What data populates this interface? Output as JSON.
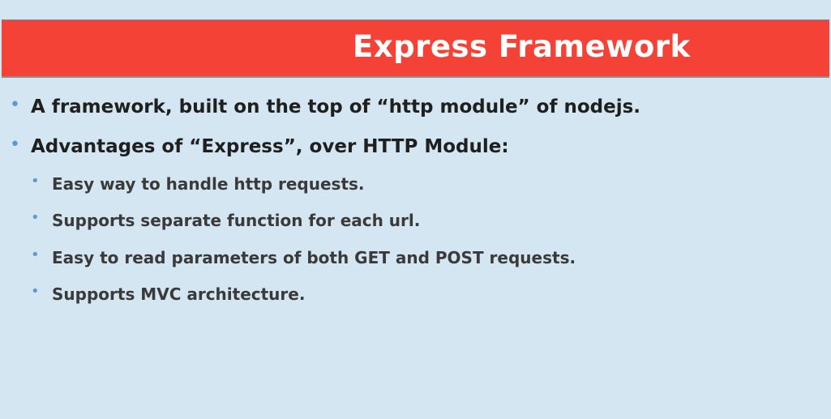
{
  "slide": {
    "title": "Express Framework",
    "bullets": [
      {
        "level": 1,
        "text": "A framework, built on the top of “http module” of nodejs."
      },
      {
        "level": 1,
        "text": "Advantages of “Express”, over HTTP Module:"
      },
      {
        "level": 2,
        "text": "Easy way to handle http requests."
      },
      {
        "level": 2,
        "text": "Supports separate function for each url."
      },
      {
        "level": 2,
        "text": "Easy to read parameters of both GET and POST requests."
      },
      {
        "level": 2,
        "text": "Supports MVC architecture."
      }
    ],
    "bullet_glyph": "•"
  },
  "colors": {
    "background": "#d4e6f1",
    "title_bar": "#f44336",
    "title_text": "#ffffff",
    "bullet": "#5b9bd5",
    "level1_text": "#1f1f1f",
    "level2_text": "#3a3a3a"
  }
}
